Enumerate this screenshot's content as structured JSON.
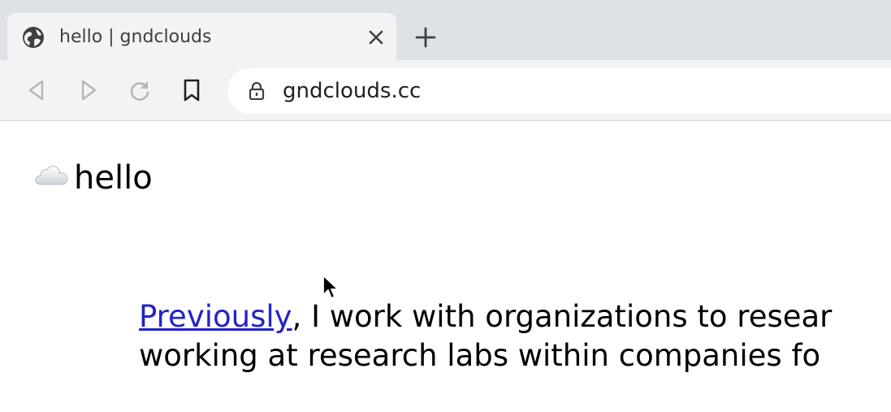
{
  "tab": {
    "title": "hello | gndclouds",
    "favicon": "globe-icon",
    "close_icon": "close-icon"
  },
  "toolbar": {
    "back_icon": "back-arrow-icon",
    "forward_icon": "forward-arrow-icon",
    "reload_icon": "reload-icon",
    "bookmark_icon": "bookmark-icon",
    "new_tab_icon": "plus-icon"
  },
  "omnibox": {
    "lock_icon": "lock-icon",
    "url": "gndclouds.cc"
  },
  "page": {
    "title_icon": "☁️",
    "title": "hello",
    "link_text": "Previously",
    "line1_rest": ", I work with organizations to resear",
    "line2": "working at research labs within companies fo"
  },
  "colors": {
    "tabstrip_bg": "#dee1e6",
    "toolbar_bg": "#f1f3f4",
    "link": "#2323c8",
    "text": "#000000"
  }
}
